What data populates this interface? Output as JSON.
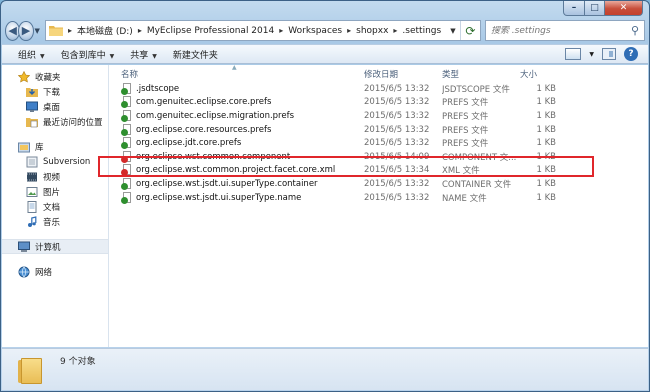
{
  "window": {
    "caption": {
      "minimize": "–",
      "maximize": "□",
      "close": "✕"
    }
  },
  "nav": {
    "back_glyph": "◀",
    "forward_glyph": "▶",
    "breadcrumbs": [
      {
        "label": "本地磁盘 (D:)"
      },
      {
        "label": "MyEclipse Professional 2014"
      },
      {
        "label": "Workspaces"
      },
      {
        "label": "shopxx"
      },
      {
        "label": ".settings"
      }
    ],
    "breadcrumb_sep": "▸",
    "search_placeholder": "搜索 .settings"
  },
  "toolbar": {
    "organize": "组织",
    "include_library": "包含到库中",
    "share": "共享",
    "new_folder": "新建文件夹",
    "help": "?"
  },
  "sidebar": {
    "favorites": {
      "label": "收藏夹",
      "items": [
        {
          "label": "下载"
        },
        {
          "label": "桌面"
        },
        {
          "label": "最近访问的位置"
        }
      ]
    },
    "libraries": {
      "label": "库",
      "items": [
        {
          "label": "Subversion"
        },
        {
          "label": "视频"
        },
        {
          "label": "图片"
        },
        {
          "label": "文档"
        },
        {
          "label": "音乐"
        }
      ]
    },
    "computer": {
      "label": "计算机"
    },
    "network": {
      "label": "网络"
    }
  },
  "columns": {
    "name": "名称",
    "date": "修改日期",
    "type": "类型",
    "size": "大小"
  },
  "files": [
    {
      "name": ".jsdtscope",
      "date": "2015/6/5 13:32",
      "type": "JSDTSCOPE 文件",
      "size": "1 KB",
      "badge": "#2f8f2f"
    },
    {
      "name": "com.genuitec.eclipse.core.prefs",
      "date": "2015/6/5 13:32",
      "type": "PREFS 文件",
      "size": "1 KB",
      "badge": "#2f8f2f"
    },
    {
      "name": "com.genuitec.eclipse.migration.prefs",
      "date": "2015/6/5 13:32",
      "type": "PREFS 文件",
      "size": "1 KB",
      "badge": "#2f8f2f"
    },
    {
      "name": "org.eclipse.core.resources.prefs",
      "date": "2015/6/5 13:32",
      "type": "PREFS 文件",
      "size": "1 KB",
      "badge": "#2f8f2f"
    },
    {
      "name": "org.eclipse.jdt.core.prefs",
      "date": "2015/6/5 13:32",
      "type": "PREFS 文件",
      "size": "1 KB",
      "badge": "#2f8f2f"
    },
    {
      "name": "org.eclipse.wst.common.component",
      "date": "2015/6/5 14:09",
      "type": "COMPONENT 文...",
      "size": "1 KB",
      "badge": "#d32a2a"
    },
    {
      "name": "org.eclipse.wst.common.project.facet.core.xml",
      "date": "2015/6/5 13:34",
      "type": "XML 文件",
      "size": "1 KB",
      "badge": "#d32a2a"
    },
    {
      "name": "org.eclipse.wst.jsdt.ui.superType.container",
      "date": "2015/6/5 13:32",
      "type": "CONTAINER 文件",
      "size": "1 KB",
      "badge": "#2f8f2f"
    },
    {
      "name": "org.eclipse.wst.jsdt.ui.superType.name",
      "date": "2015/6/5 13:32",
      "type": "NAME 文件",
      "size": "1 KB",
      "badge": "#2f8f2f"
    }
  ],
  "status": {
    "count": "9 个对象"
  }
}
